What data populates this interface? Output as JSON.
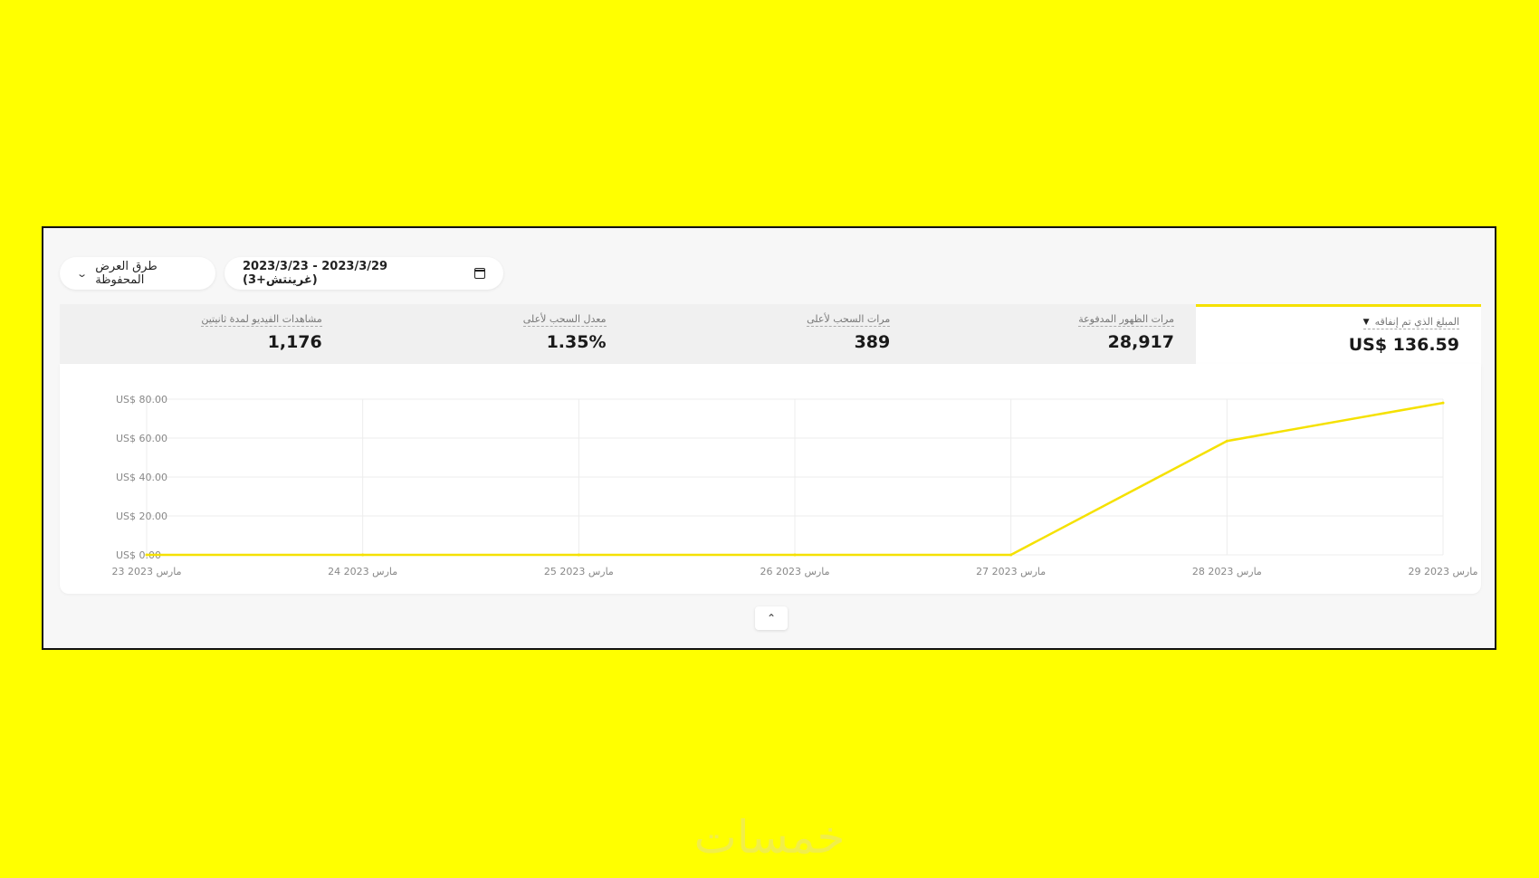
{
  "toolbar": {
    "saved_views_label": "طرق العرض المحفوظة",
    "date_range_label": "2023/3/23 - 2023/3/29 (غرينتش+3)"
  },
  "metrics": [
    {
      "label": "المبلغ الذي تم إنفاقه",
      "value": "US$ 136.59",
      "active": true
    },
    {
      "label": "مرات الظهور المدفوعة",
      "value": "28,917"
    },
    {
      "label": "مرات السحب لأعلى",
      "value": "389"
    },
    {
      "label": "معدل السحب لأعلى",
      "value": "1.35%"
    },
    {
      "label": "مشاهدات الفيديو لمدة ثانيتين",
      "value": "1,176"
    }
  ],
  "chart_data": {
    "type": "line",
    "categories": [
      "23 مارس 2023",
      "24 مارس 2023",
      "25 مارس 2023",
      "26 مارس 2023",
      "27 مارس 2023",
      "28 مارس 2023",
      "29 مارس 2023"
    ],
    "values": [
      0,
      0,
      0,
      0,
      0,
      58.5,
      78.1
    ],
    "y_ticks": [
      "US$ 0.00",
      "US$ 20.00",
      "US$ 40.00",
      "US$ 60.00",
      "US$ 80.00"
    ],
    "ylim": [
      0,
      80
    ],
    "grid": true,
    "line_color": "#f5e100"
  },
  "watermark": "خمسات",
  "colors": {
    "background": "#ffff00",
    "accent": "#f5e100"
  }
}
